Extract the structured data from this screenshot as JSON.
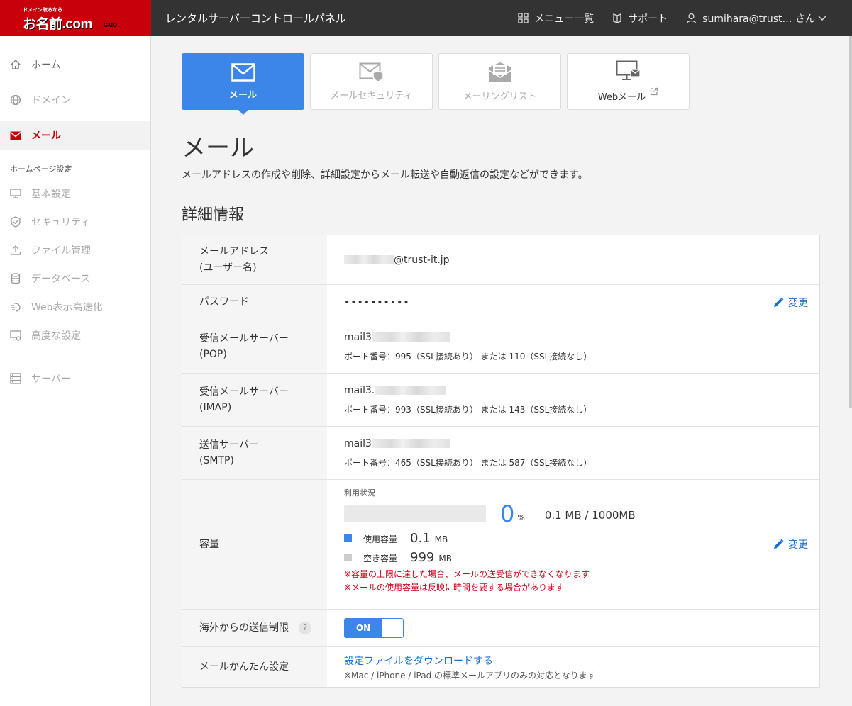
{
  "header": {
    "logo_tag": "ドメイン取るなら",
    "logo_main": "お名前.com",
    "logo_gmo": "GMO",
    "title": "レンタルサーバーコントロールパネル",
    "menu_label": "メニュー一覧",
    "support_label": "サポート",
    "user_label": "sumihara@trust… さん"
  },
  "sidebar": {
    "items": [
      {
        "label": "ホーム",
        "icon": "home-icon"
      },
      {
        "label": "ドメイン",
        "icon": "globe-icon"
      },
      {
        "label": "メール",
        "icon": "mail-icon"
      }
    ],
    "section_label": "ホームページ設定",
    "sub_items": [
      {
        "label": "基本設定",
        "icon": "monitor-icon"
      },
      {
        "label": "セキュリティ",
        "icon": "shield-icon"
      },
      {
        "label": "ファイル管理",
        "icon": "upload-icon"
      },
      {
        "label": "データベース",
        "icon": "database-icon"
      },
      {
        "label": "Web表示高速化",
        "icon": "speed-icon"
      },
      {
        "label": "高度な設定",
        "icon": "advanced-icon"
      }
    ],
    "server_label": "サーバー"
  },
  "tabs": [
    {
      "label": "メール",
      "icon": "mail-icon",
      "active": true
    },
    {
      "label": "メールセキュリティ",
      "icon": "mail-shield-icon"
    },
    {
      "label": "メーリングリスト",
      "icon": "mailing-list-icon"
    },
    {
      "label": "Webメール",
      "icon": "webmail-icon"
    }
  ],
  "page": {
    "title": "メール",
    "description": "メールアドレスの作成や削除、詳細設定からメール転送や自動返信の設定などができます。",
    "section_title": "詳細情報"
  },
  "details": {
    "email_label_1": "メールアドレス",
    "email_label_2": "(ユーザー名)",
    "email_value": "@trust-it.jp",
    "password_label": "パスワード",
    "password_value": "••••••••••",
    "edit_label": "変更",
    "pop_label_1": "受信メールサーバー",
    "pop_label_2": "(POP)",
    "pop_value": "mail3",
    "pop_port": "ポート番号：995（SSL接続あり） または 110（SSL接続なし）",
    "imap_label_1": "受信メールサーバー",
    "imap_label_2": "(IMAP)",
    "imap_value": "mail3.",
    "imap_port": "ポート番号：993（SSL接続あり） または 143（SSL接続なし）",
    "smtp_label_1": "送信サーバー",
    "smtp_label_2": "(SMTP)",
    "smtp_value": "mail3",
    "smtp_port": "ポート番号：465（SSL接続あり） または 587（SSL接続なし）",
    "capacity_label": "容量",
    "usage_label": "利用状況",
    "usage_percent": "0",
    "usage_percent_unit": "%",
    "usage_total": "0.1 MB / 1000MB",
    "used_label": "使用容量",
    "used_value": "0.1",
    "used_unit": "MB",
    "free_label": "空き容量",
    "free_value": "999",
    "free_unit": "MB",
    "warning_1": "※容量の上限に達した場合、メールの送受信ができなくなります",
    "warning_2": "※メールの使用容量は反映に時間を要する場合があります",
    "overseas_label": "海外からの送信制限",
    "help_glyph": "?",
    "toggle_label": "ON",
    "easy_label": "メールかんたん設定",
    "download_link": "設定ファイルをダウンロードする",
    "download_note": "※Mac / iPhone / iPad の標準メールアプリのみの対応となります"
  },
  "colors": {
    "brand_red": "#c8000b",
    "accent_blue": "#3b86e8",
    "link_blue": "#1a6fcf",
    "warning_red": "#d0021b"
  }
}
